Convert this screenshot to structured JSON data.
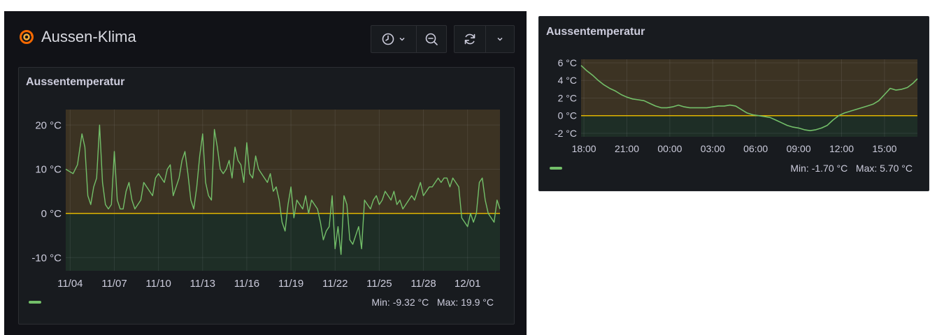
{
  "dashboard": {
    "title": "Aussen-Klima"
  },
  "toolbar": {
    "time_picker_icon": "clock-icon",
    "zoom_out_icon": "zoom-out-icon",
    "refresh_icon": "refresh-icon",
    "refresh_menu_icon": "chevron-down-icon"
  },
  "colors": {
    "line": "#73bf69",
    "threshold": "#e0b400",
    "upper_fill": "#3c3323",
    "lower_fill": "#1e2e26"
  },
  "panel_main": {
    "title": "Aussentemperatur",
    "stats": {
      "min_label": "Min:",
      "min_value": "-9.32 °C",
      "max_label": "Max:",
      "max_value": "19.9 °C"
    }
  },
  "panel_small": {
    "title": "Aussentemperatur",
    "stats": {
      "min_label": "Min:",
      "min_value": "-1.70 °C",
      "max_label": "Max:",
      "max_value": "5.70 °C"
    }
  },
  "chart_data": [
    {
      "type": "line",
      "title": "Aussentemperatur",
      "unit": "°C",
      "x_tick_labels": [
        "11/04",
        "11/07",
        "11/10",
        "11/13",
        "11/16",
        "11/19",
        "11/22",
        "11/25",
        "11/28",
        "12/01"
      ],
      "y_tick_labels": [
        "20 °C",
        "10 °C",
        "0 °C",
        "-10 °C"
      ],
      "y_ticks": [
        20,
        10,
        0,
        -10
      ],
      "xlim": [
        -0.3,
        29.2
      ],
      "ylim": [
        -13,
        23.5
      ],
      "threshold": 0,
      "grid": true,
      "x": [
        -0.3,
        0.2,
        0.5,
        0.8,
        1.0,
        1.2,
        1.4,
        1.6,
        1.8,
        2.0,
        2.2,
        2.4,
        2.6,
        2.8,
        3.0,
        3.2,
        3.4,
        3.6,
        3.8,
        4.0,
        4.2,
        4.4,
        4.6,
        4.8,
        5.0,
        5.2,
        5.4,
        5.6,
        5.8,
        6.0,
        6.2,
        6.4,
        6.6,
        6.8,
        7.0,
        7.2,
        7.4,
        7.6,
        7.8,
        8.0,
        8.2,
        8.4,
        8.6,
        8.8,
        9.0,
        9.2,
        9.4,
        9.6,
        9.8,
        10.0,
        10.2,
        10.4,
        10.6,
        10.8,
        11.0,
        11.2,
        11.4,
        11.6,
        11.8,
        12.0,
        12.2,
        12.4,
        12.6,
        12.8,
        13.0,
        13.2,
        13.4,
        13.6,
        13.8,
        14.0,
        14.2,
        14.4,
        14.6,
        14.8,
        15.0,
        15.2,
        15.4,
        15.6,
        15.8,
        16.0,
        16.2,
        16.4,
        16.6,
        16.8,
        17.0,
        17.2,
        17.4,
        17.6,
        17.8,
        18.0,
        18.2,
        18.4,
        18.6,
        18.8,
        19.0,
        19.2,
        19.4,
        19.6,
        19.8,
        20.0,
        20.2,
        20.4,
        20.6,
        20.8,
        21.0,
        21.2,
        21.4,
        21.6,
        21.8,
        22.0,
        22.2,
        22.4,
        22.6,
        22.8,
        23.0,
        23.2,
        23.4,
        23.6,
        23.8,
        24.0,
        24.2,
        24.4,
        24.6,
        24.8,
        25.0,
        25.2,
        25.4,
        25.6,
        25.8,
        26.0,
        26.2,
        26.4,
        26.6,
        26.8,
        27.0,
        27.2,
        27.4,
        27.6,
        27.8,
        28.0,
        28.2,
        28.4,
        28.6,
        28.8,
        29.0,
        29.2
      ],
      "y": [
        10,
        9,
        11,
        18,
        15,
        4,
        2,
        6,
        8,
        20,
        7,
        2,
        1,
        2,
        14,
        3,
        1,
        1,
        5,
        7,
        3,
        1,
        2,
        3,
        7,
        6,
        5,
        4,
        8,
        9,
        8,
        7,
        10,
        11,
        4,
        6,
        8,
        12,
        14,
        9,
        3,
        1,
        6,
        13,
        18,
        7,
        4,
        3,
        19,
        15,
        10,
        9,
        10,
        12,
        8,
        15,
        12,
        11,
        7,
        16,
        9,
        8,
        13,
        10,
        9,
        8,
        7,
        9,
        5,
        6,
        3,
        -2,
        -4,
        2,
        6,
        -1,
        3,
        2,
        1,
        4,
        0,
        3,
        2,
        1,
        -2,
        -6,
        -4,
        -3,
        4,
        -8,
        -3,
        -9.3,
        4,
        2,
        -6,
        -7,
        -5,
        -3,
        -8,
        3,
        2,
        1,
        3,
        4,
        2,
        3,
        5,
        4,
        3,
        5,
        2,
        3,
        1,
        2,
        3,
        4,
        3,
        5,
        7,
        4,
        5,
        6,
        6,
        7,
        8,
        7,
        8,
        8,
        6,
        8,
        7,
        6,
        -1,
        -2,
        -3,
        0,
        -2,
        0,
        7,
        8,
        3,
        0,
        -1,
        -2,
        3,
        1
      ]
    },
    {
      "type": "line",
      "title": "Aussentemperatur",
      "unit": "°C",
      "x_tick_labels": [
        "18:00",
        "21:00",
        "00:00",
        "03:00",
        "06:00",
        "09:00",
        "12:00",
        "15:00"
      ],
      "y_tick_labels": [
        "6 °C",
        "4 °C",
        "2 °C",
        "0 °C",
        "-2 °C"
      ],
      "y_ticks": [
        6,
        4,
        2,
        0,
        -2
      ],
      "xlim": [
        -0.2,
        23.3
      ],
      "ylim": [
        -2.4,
        6.4
      ],
      "threshold": 0,
      "grid": true,
      "x": [
        -0.2,
        0.2,
        0.6,
        1.0,
        1.4,
        1.8,
        2.2,
        2.6,
        3.0,
        3.4,
        3.8,
        4.2,
        4.6,
        5.0,
        5.4,
        5.8,
        6.2,
        6.6,
        7.0,
        7.4,
        7.8,
        8.2,
        8.6,
        9.0,
        9.4,
        9.8,
        10.2,
        10.6,
        11.0,
        11.4,
        11.8,
        12.2,
        12.6,
        13.0,
        13.4,
        13.8,
        14.2,
        14.6,
        15.0,
        15.4,
        15.8,
        16.2,
        16.6,
        17.0,
        17.4,
        17.8,
        18.2,
        18.6,
        19.0,
        19.4,
        19.8,
        20.2,
        20.6,
        21.0,
        21.4,
        21.8,
        22.2,
        22.6,
        23.0,
        23.3
      ],
      "y": [
        5.7,
        5.1,
        4.6,
        4.0,
        3.5,
        3.1,
        2.8,
        2.4,
        2.1,
        1.9,
        1.8,
        1.7,
        1.4,
        1.1,
        0.9,
        0.9,
        1.0,
        1.2,
        1.0,
        0.9,
        0.9,
        0.9,
        0.9,
        1.0,
        1.1,
        1.1,
        1.2,
        1.1,
        0.7,
        0.3,
        0.1,
        0.0,
        -0.1,
        -0.2,
        -0.5,
        -0.8,
        -1.1,
        -1.3,
        -1.4,
        -1.6,
        -1.7,
        -1.6,
        -1.4,
        -1.1,
        -0.5,
        0.0,
        0.3,
        0.5,
        0.7,
        0.9,
        1.1,
        1.3,
        1.7,
        2.4,
        3.1,
        2.9,
        3.0,
        3.2,
        3.7,
        4.2
      ]
    }
  ]
}
